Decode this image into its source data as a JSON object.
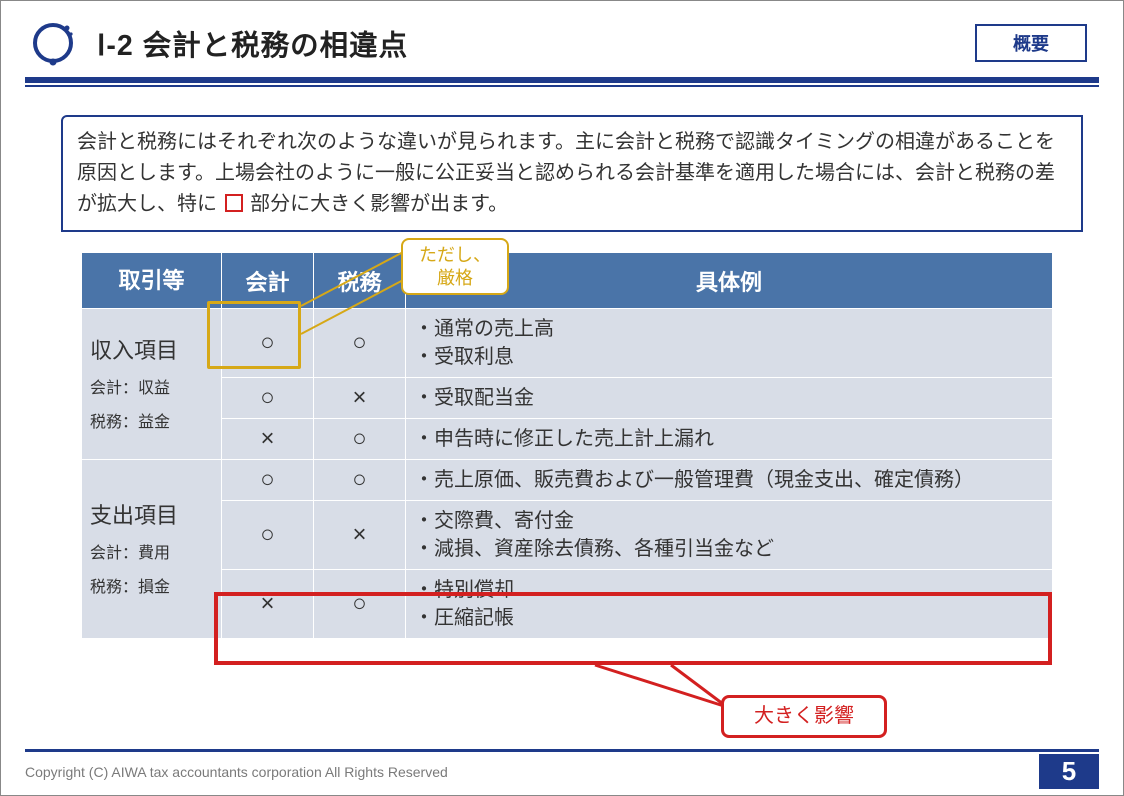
{
  "header": {
    "title": "Ⅰ-2  会計と税務の相違点",
    "badge": "概要"
  },
  "intro": {
    "line1a": "会計と税務にはそれぞれ次のような違いが見られます。主に会計と税務で認識タイミングの相違があることを原因とします。上場会社のように一般に公正妥当と認められる会計基準を適用した場合には、会計と税務の差が拡大し、特に",
    "line1b": "部分に大きく影響が出ます。"
  },
  "table": {
    "headers": {
      "tx": "取引等",
      "ac": "会計",
      "tax": "税務",
      "ex": "具体例"
    },
    "row1": {
      "name_main": "収入項目",
      "name_sub1": "会計：収益",
      "name_sub2": "税務：益金",
      "r1_ac": "○",
      "r1_tax": "○",
      "r1_ex": "・通常の売上高\n・受取利息",
      "r2_ac": "○",
      "r2_tax": "×",
      "r2_ex": "・受取配当金",
      "r3_ac": "×",
      "r3_tax": "○",
      "r3_ex": "・申告時に修正した売上計上漏れ"
    },
    "row2": {
      "name_main": "支出項目",
      "name_sub1": "会計：費用",
      "name_sub2": "税務：損金",
      "r1_ac": "○",
      "r1_tax": "○",
      "r1_ex": "・売上原価、販売費および一般管理費（現金支出、確定債務）",
      "r2_ac": "○",
      "r2_tax": "×",
      "r2_ex": "・交際費、寄付金\n・減損、資産除去債務、各種引当金など",
      "r3_ac": "×",
      "r3_tax": "○",
      "r3_ex": "・特別償却\n・圧縮記帳"
    }
  },
  "callouts": {
    "gold": "ただし、\n厳格",
    "red": "大きく影響"
  },
  "footer": {
    "copyright": "Copyright (C) AIWA tax accountants corporation All Rights Reserved",
    "page": "5"
  },
  "colors": {
    "navy": "#1e3a8a",
    "gold": "#d6a817",
    "red": "#d32020",
    "cell": "#d8dde7",
    "head": "#4a74a8"
  }
}
